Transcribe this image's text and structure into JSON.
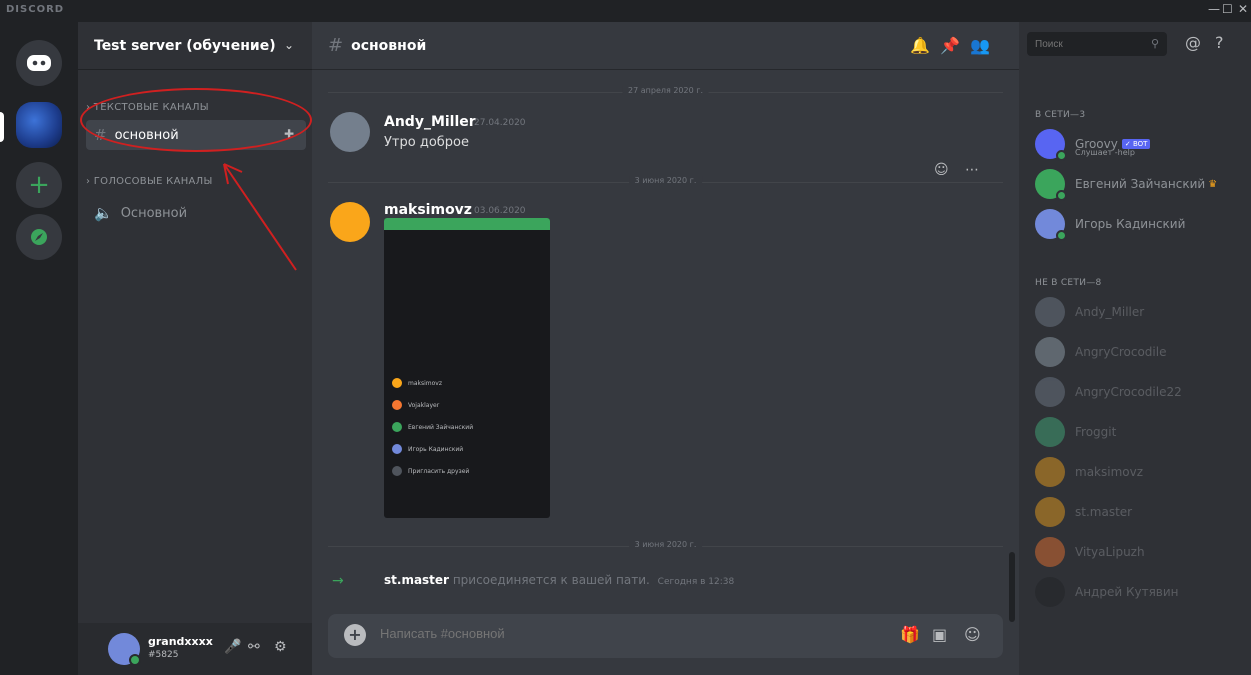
{
  "app": {
    "title": "DISCORD"
  },
  "window": {
    "minimize": "—",
    "maximize": "☐",
    "close": "✕"
  },
  "server": {
    "name": "Test server (обучение)"
  },
  "sidebar": {
    "text_category": "ТЕКСТОВЫЕ КАНАЛЫ",
    "voice_category": "ГОЛОСОВЫЕ КАНАЛЫ",
    "text_channel": "основной",
    "voice_channel": "Основной"
  },
  "user": {
    "name": "grandxxxx",
    "tag": "#5825"
  },
  "channel": {
    "title": "основной"
  },
  "messages": [
    {
      "divider": "27 апреля 2020 г.",
      "author": "Andy_Miller",
      "time": "27.04.2020",
      "text": "Утро доброе"
    },
    {
      "divider": "3 июня 2020 г.",
      "author": "maksimovz",
      "time": "03.06.2020"
    }
  ],
  "embed": {
    "rows": [
      "maksimovz",
      "Vojaklayer",
      "Евгений Зайчанский",
      "Игорь Кадинский",
      "Пригласить друзей"
    ]
  },
  "join": {
    "divider": "3 июня 2020 г.",
    "user": "st.master",
    "text": "присоединяется к вашей пати.",
    "time": "Сегодня в 12:38"
  },
  "composer": {
    "placeholder": "Написать #основной"
  },
  "members": {
    "search_placeholder": "Поиск",
    "online_header": "В СЕТИ—3",
    "offline_header": "НЕ В СЕТИ—8",
    "online": [
      {
        "name": "Groovy",
        "sub": "Слушает -help",
        "bot": "✓ BOT",
        "color": "#5865f2"
      },
      {
        "name": "Евгений Зайчанский",
        "color": "#3ba55c"
      },
      {
        "name": "Игорь Кадинский",
        "color": "#7289da"
      }
    ],
    "offline": [
      {
        "name": "Andy_Miller",
        "color": "#747f8d"
      },
      {
        "name": "AngryCrocodile",
        "color": "#99aab5"
      },
      {
        "name": "AngryCrocodile22",
        "color": "#747f8d"
      },
      {
        "name": "Froggit",
        "color": "#43b581"
      },
      {
        "name": "maksimovz",
        "color": "#faa61a"
      },
      {
        "name": "st.master",
        "color": "#faa61a"
      },
      {
        "name": "VityaLipuzh",
        "color": "#f57731"
      },
      {
        "name": "Андрей Кутявин",
        "color": "#36393f"
      }
    ]
  }
}
